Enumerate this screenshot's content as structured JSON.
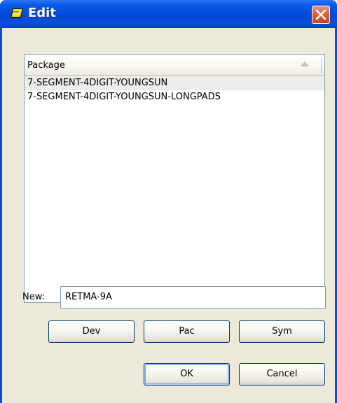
{
  "window": {
    "title": "Edit",
    "icon": "book-icon",
    "close_icon": "close-icon",
    "accent": "#0548d6",
    "close_color": "#e0603c"
  },
  "list": {
    "column_header": "Package",
    "sort_icon": "sort-ascending-icon",
    "items": [
      {
        "label": "7-SEGMENT-4DIGIT-YOUNGSUN",
        "selected": true
      },
      {
        "label": "7-SEGMENT-4DIGIT-YOUNGSUN-LONGPADS",
        "selected": false
      }
    ]
  },
  "new_field": {
    "label": "New:",
    "value": "RETMA-9A"
  },
  "buttons": {
    "dev": "Dev",
    "pac": "Pac",
    "sym": "Sym",
    "ok": "OK",
    "cancel": "Cancel"
  }
}
